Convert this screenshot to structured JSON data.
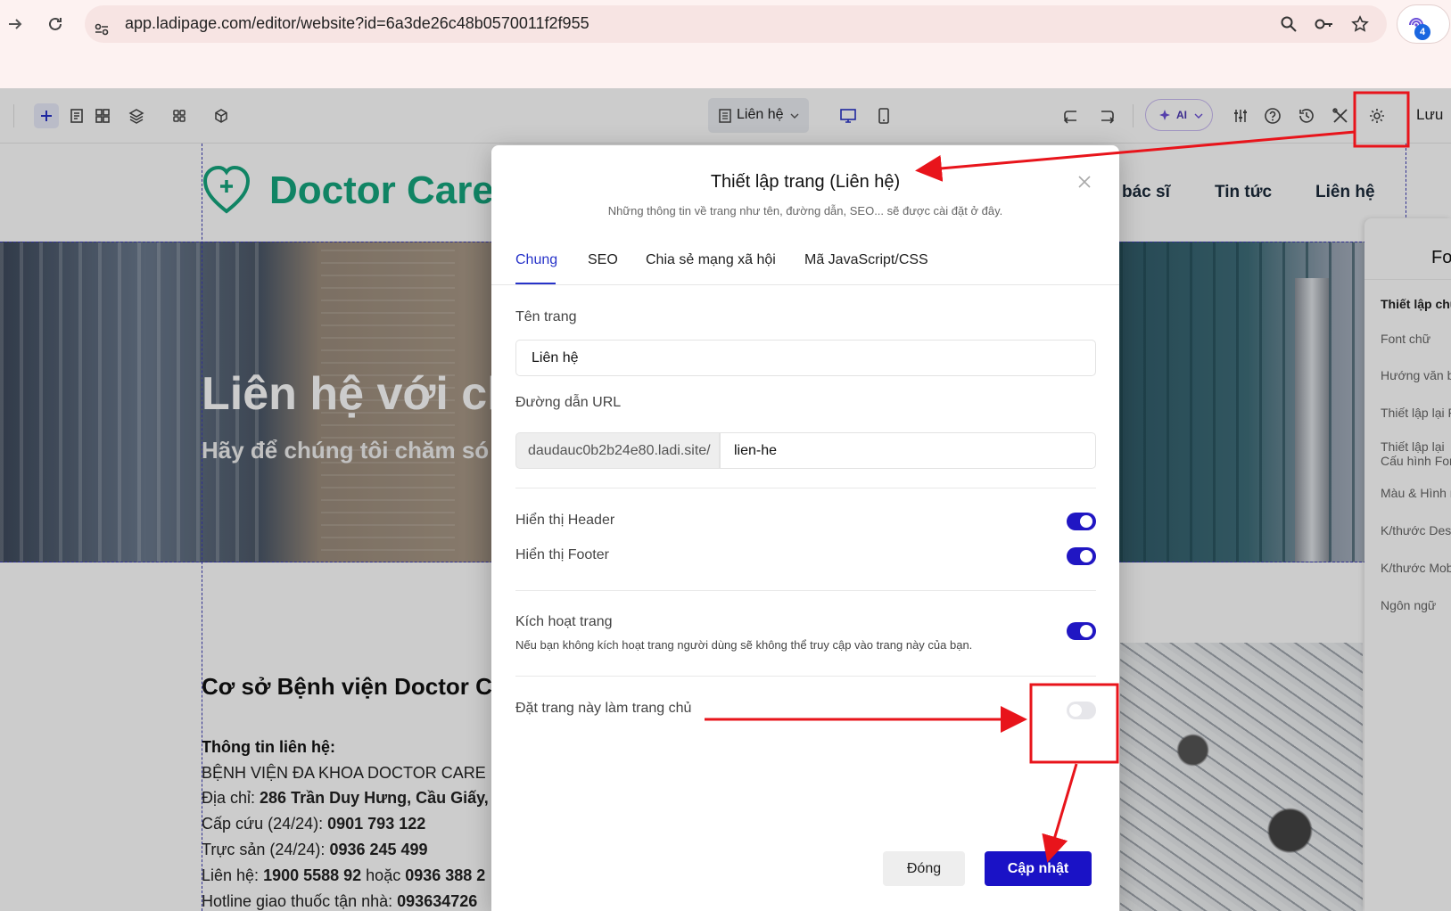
{
  "browser": {
    "url": "app.ladipage.com/editor/website?id=6a3de26c48b0570011f2f955",
    "extension_badge": "4"
  },
  "toolbar": {
    "page_selector": "Liên hệ",
    "ai_label": "AI",
    "save_label": "Lưu"
  },
  "site": {
    "logo": "Doctor Care",
    "menu": [
      "bác sĩ",
      "Tin tức",
      "Liên hệ"
    ],
    "hero_title": "Liên hệ với ch",
    "hero_subtitle": "Hãy để chúng tôi chăm só",
    "info_heading": "Cơ sở Bệnh viện Doctor C",
    "info_lines": [
      {
        "label": "Thông tin liên hệ:",
        "value": ""
      },
      {
        "label": "BỆNH VIỆN ĐA KHOA DOCTOR CARE",
        "value": ""
      },
      {
        "label": "Địa chỉ: ",
        "value": "286 Trần Duy Hưng, Cầu Giấy, H"
      },
      {
        "label": "Cấp cứu (24/24): ",
        "value": "0901 793 122"
      },
      {
        "label": "Trực sản (24/24): ",
        "value": "0936 245 499"
      },
      {
        "label": "Liên hệ: ",
        "value": "1900 5588 92",
        "label2": " hoặc ",
        "value2": "0936 388 2"
      },
      {
        "label": "Hotline giao thuốc tận nhà: ",
        "value": "093634726"
      }
    ]
  },
  "right_panel": {
    "title": "Fo",
    "heading": "Thiết lập chu",
    "items": [
      "Font chữ",
      "Hướng văn bả",
      "Thiết lập lại F",
      "Thiết lập lại\nCấu hình Forr",
      "Màu & Hình n",
      "K/thước Deskt",
      "K/thước Mob",
      "Ngôn ngữ"
    ]
  },
  "modal": {
    "title": "Thiết lập trang (Liên hệ)",
    "subtitle": "Những thông tin về trang như tên, đường dẫn, SEO... sẽ được cài đặt ở đây.",
    "tabs": [
      "Chung",
      "SEO",
      "Chia sẻ mạng xã hội",
      "Mã JavaScript/CSS"
    ],
    "active_tab": "Chung",
    "page_name_label": "Tên trang",
    "page_name_value": "Liên hệ",
    "url_label": "Đường dẫn URL",
    "url_prefix": "daudauc0b2b24e80.ladi.site/",
    "url_slug": "lien-he",
    "show_header_label": "Hiển thị Header",
    "show_header": true,
    "show_footer_label": "Hiển thị Footer",
    "show_footer": true,
    "activate_label": "Kích hoạt trang",
    "activate_help": "Nếu bạn không kích hoạt trang người dùng sẽ không thể truy cập vào trang này của bạn.",
    "activate": true,
    "homepage_label": "Đặt trang này làm trang chủ",
    "homepage": false,
    "close_label": "Đóng",
    "update_label": "Cập nhật"
  },
  "colors": {
    "brand_green": "#14a57d",
    "primary_blue": "#1a12c6",
    "annotation_red": "#e8141b"
  }
}
